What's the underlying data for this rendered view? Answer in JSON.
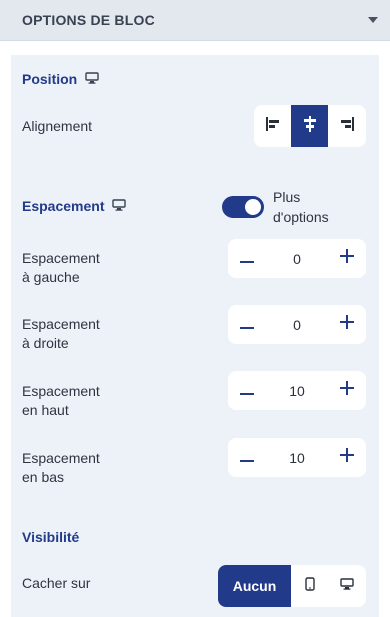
{
  "header": {
    "title": "OPTIONS DE BLOC",
    "caret_icon": "caret-down-icon"
  },
  "position": {
    "title": "Position",
    "device_icon": "desktop-icon",
    "alignment_label": "Alignement",
    "alignment_options": [
      "align-left-icon",
      "align-center-icon",
      "align-right-icon"
    ],
    "alignment_selected": "align-center-icon"
  },
  "spacing": {
    "title": "Espacement",
    "device_icon": "desktop-icon",
    "more_options_label_line1": "Plus",
    "more_options_label_line2": "d'options",
    "more_options_enabled": true,
    "fields": [
      {
        "label_line1": "Espacement",
        "label_line2": "à gauche",
        "value": "0"
      },
      {
        "label_line1": "Espacement",
        "label_line2": "à droite",
        "value": "0"
      },
      {
        "label_line1": "Espacement",
        "label_line2": "en haut",
        "value": "10"
      },
      {
        "label_line1": "Espacement",
        "label_line2": "en bas",
        "value": "10"
      }
    ]
  },
  "visibility": {
    "title": "Visibilité",
    "hide_on_label": "Cacher sur",
    "none_label": "Aucun",
    "options": [
      "mobile-icon",
      "desktop-icon"
    ]
  },
  "colors": {
    "accent": "#213a8a",
    "panel_bg": "#edf2f8",
    "header_bg": "#e3e8ef"
  }
}
